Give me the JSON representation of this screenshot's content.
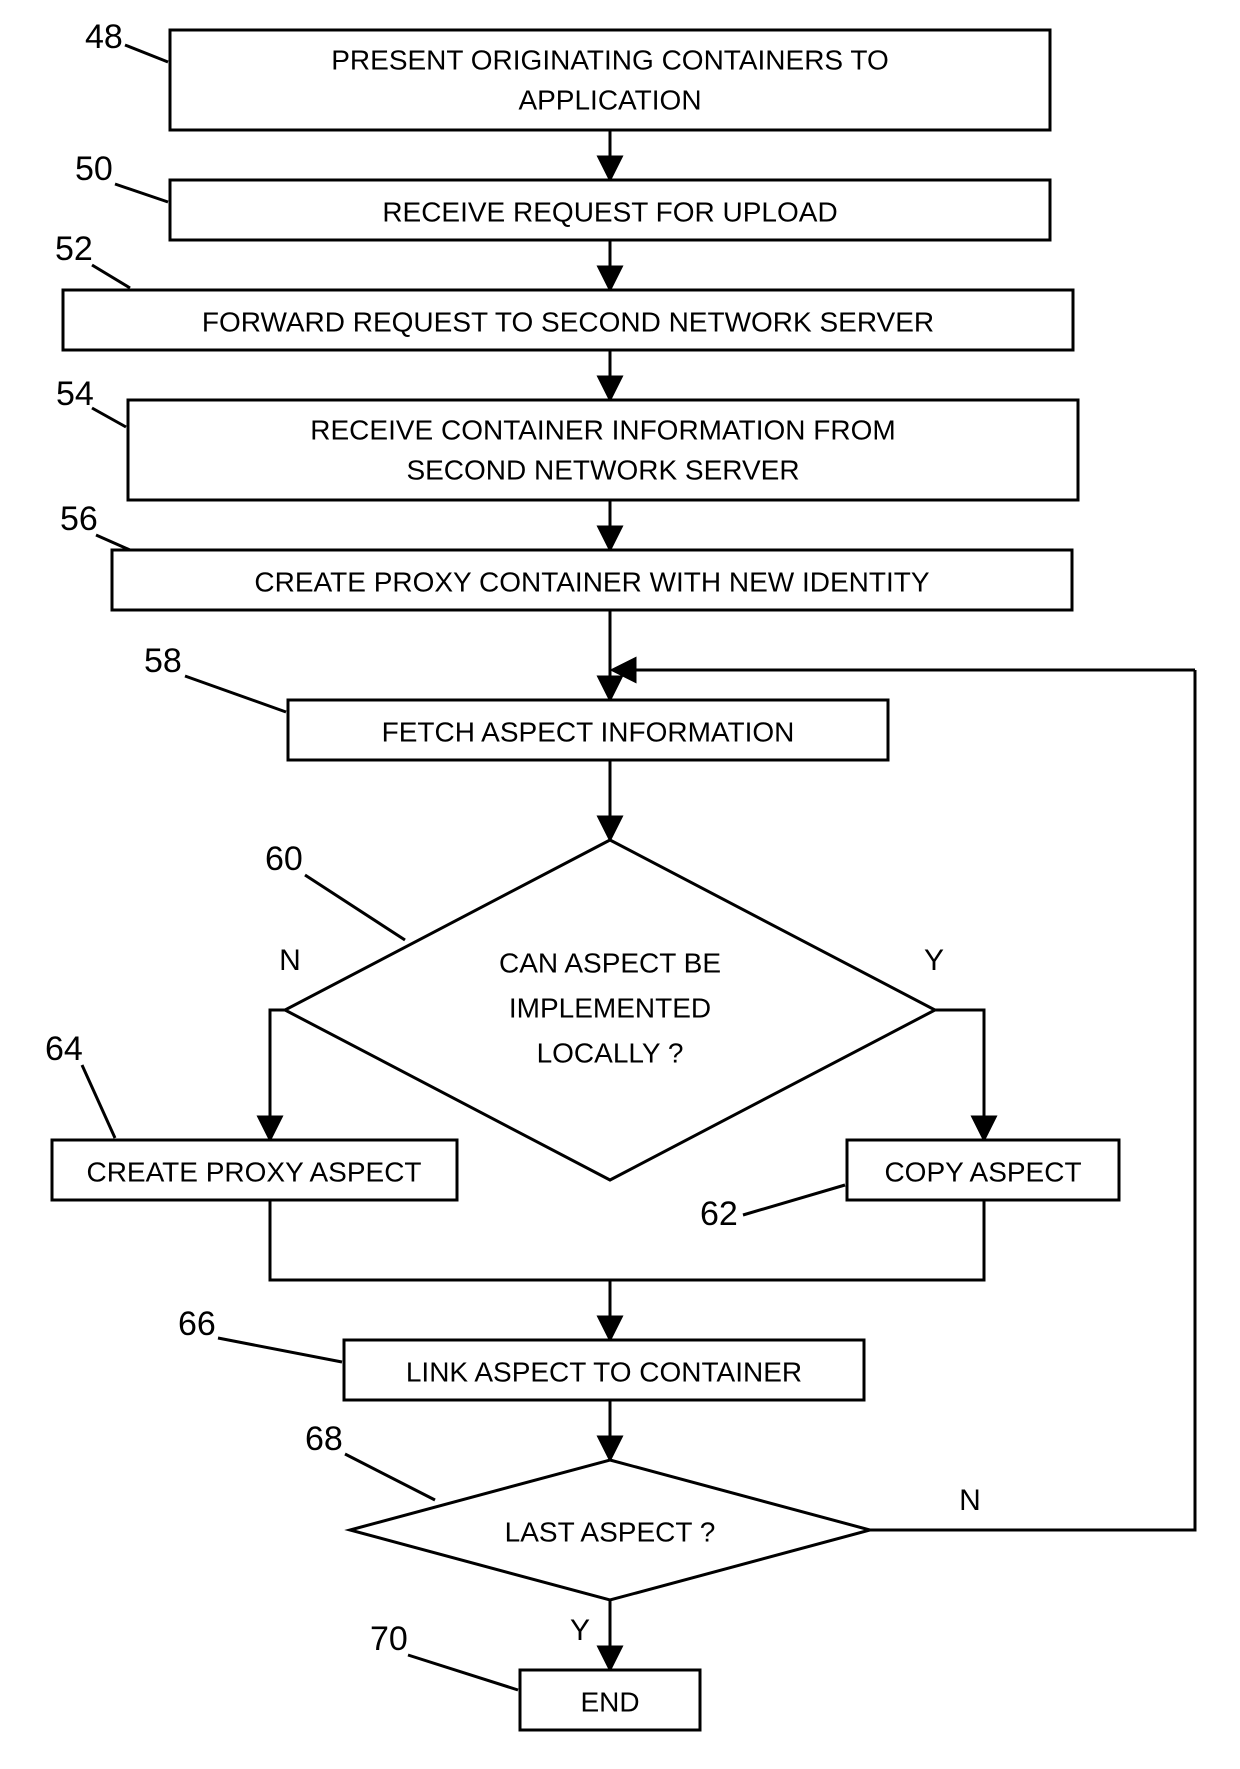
{
  "chart_data": {
    "type": "flowchart",
    "nodes": [
      {
        "id": "48",
        "ref": "48",
        "shape": "rect",
        "text": [
          "PRESENT ORIGINATING CONTAINERS TO",
          "APPLICATION"
        ]
      },
      {
        "id": "50",
        "ref": "50",
        "shape": "rect",
        "text": [
          "RECEIVE REQUEST FOR UPLOAD"
        ]
      },
      {
        "id": "52",
        "ref": "52",
        "shape": "rect",
        "text": [
          "FORWARD REQUEST TO SECOND NETWORK SERVER"
        ]
      },
      {
        "id": "54",
        "ref": "54",
        "shape": "rect",
        "text": [
          "RECEIVE CONTAINER INFORMATION FROM",
          "SECOND NETWORK SERVER"
        ]
      },
      {
        "id": "56",
        "ref": "56",
        "shape": "rect",
        "text": [
          "CREATE PROXY CONTAINER WITH NEW IDENTITY"
        ]
      },
      {
        "id": "58",
        "ref": "58",
        "shape": "rect",
        "text": [
          "FETCH ASPECT INFORMATION"
        ]
      },
      {
        "id": "60",
        "ref": "60",
        "shape": "diamond",
        "text": [
          "CAN ASPECT BE",
          "IMPLEMENTED",
          "LOCALLY  ?"
        ]
      },
      {
        "id": "62",
        "ref": "62",
        "shape": "rect",
        "text": [
          "COPY ASPECT"
        ]
      },
      {
        "id": "64",
        "ref": "64",
        "shape": "rect",
        "text": [
          "CREATE PROXY ASPECT"
        ]
      },
      {
        "id": "66",
        "ref": "66",
        "shape": "rect",
        "text": [
          "LINK ASPECT TO CONTAINER"
        ]
      },
      {
        "id": "68",
        "ref": "68",
        "shape": "diamond",
        "text": [
          "LAST ASPECT ?"
        ]
      },
      {
        "id": "70",
        "ref": "70",
        "shape": "rect",
        "text": [
          "END"
        ]
      }
    ],
    "edges": [
      {
        "from": "48",
        "to": "50"
      },
      {
        "from": "50",
        "to": "52"
      },
      {
        "from": "52",
        "to": "54"
      },
      {
        "from": "54",
        "to": "56"
      },
      {
        "from": "56",
        "to": "58"
      },
      {
        "from": "58",
        "to": "60"
      },
      {
        "from": "60",
        "to": "64",
        "label": "N"
      },
      {
        "from": "60",
        "to": "62",
        "label": "Y"
      },
      {
        "from": "64",
        "to": "66"
      },
      {
        "from": "62",
        "to": "66"
      },
      {
        "from": "66",
        "to": "68"
      },
      {
        "from": "68",
        "to": "70",
        "label": "Y"
      },
      {
        "from": "68",
        "to": "58",
        "label": "N",
        "loop": true
      }
    ]
  },
  "labels": {
    "N": "N",
    "Y": "Y"
  }
}
